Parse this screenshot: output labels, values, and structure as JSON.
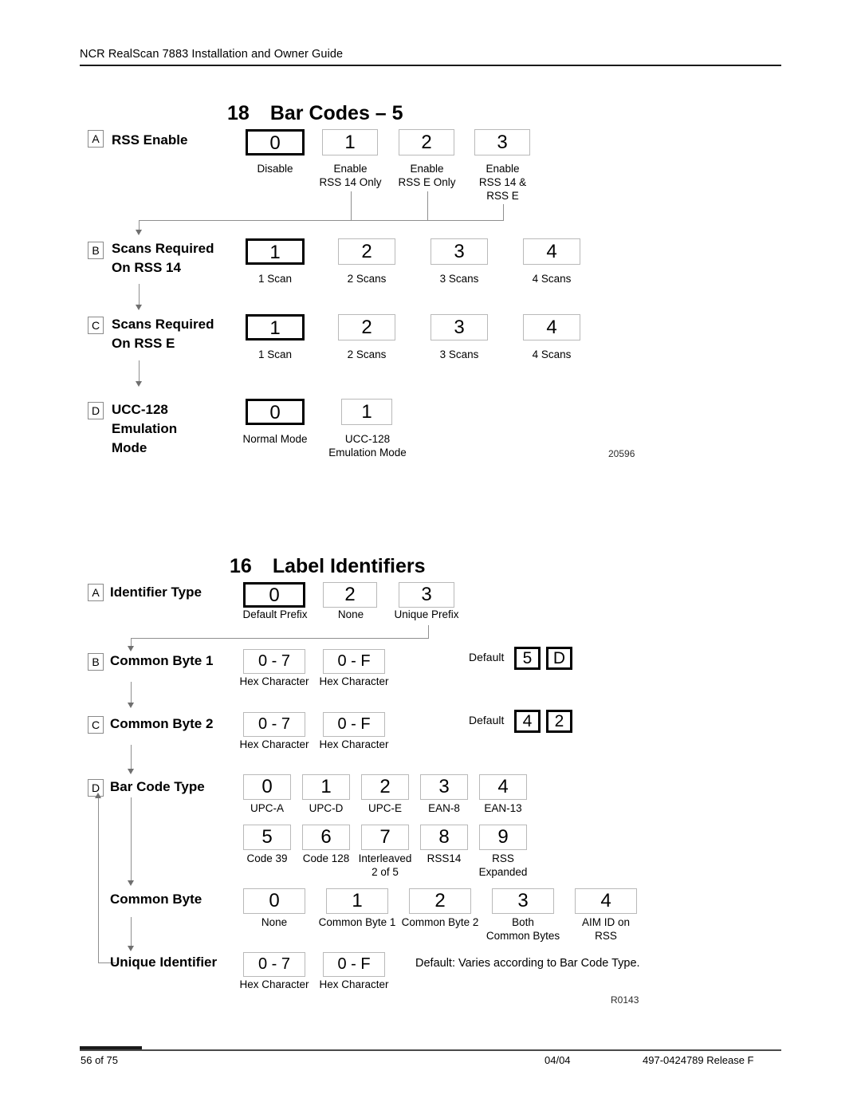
{
  "header": {
    "title": "NCR RealScan 7883 Installation and Owner Guide"
  },
  "footer": {
    "page": "56 of 75",
    "date": "04/04",
    "doc": "497-0424789  Release F"
  },
  "section_barcodes": {
    "number": "18",
    "title": "Bar Codes – 5",
    "figref": "20596",
    "rows": [
      {
        "badge": "A",
        "label": "RSS Enable",
        "boxes": [
          {
            "value": "0",
            "caption": "Disable",
            "selected": true
          },
          {
            "value": "1",
            "caption": "Enable\nRSS 14 Only",
            "selected": false
          },
          {
            "value": "2",
            "caption": "Enable\nRSS E Only",
            "selected": false
          },
          {
            "value": "3",
            "caption": "Enable\nRSS 14 &\nRSS E",
            "selected": false
          }
        ]
      },
      {
        "badge": "B",
        "label": "Scans Required\nOn RSS 14",
        "boxes": [
          {
            "value": "1",
            "caption": "1 Scan",
            "selected": true
          },
          {
            "value": "2",
            "caption": "2 Scans",
            "selected": false
          },
          {
            "value": "3",
            "caption": "3 Scans",
            "selected": false
          },
          {
            "value": "4",
            "caption": "4 Scans",
            "selected": false
          }
        ]
      },
      {
        "badge": "C",
        "label": "Scans Required\nOn RSS E",
        "boxes": [
          {
            "value": "1",
            "caption": "1 Scan",
            "selected": true
          },
          {
            "value": "2",
            "caption": "2 Scans",
            "selected": false
          },
          {
            "value": "3",
            "caption": "3 Scans",
            "selected": false
          },
          {
            "value": "4",
            "caption": "4 Scans",
            "selected": false
          }
        ]
      },
      {
        "badge": "D",
        "label": "UCC-128\nEmulation\nMode",
        "boxes": [
          {
            "value": "0",
            "caption": "Normal Mode",
            "selected": true
          },
          {
            "value": "1",
            "caption": "UCC-128\nEmulation Mode",
            "selected": false
          }
        ]
      }
    ]
  },
  "section_labelids": {
    "number": "16",
    "title": "Label Identifiers",
    "figref": "R0143",
    "default_label": "Default",
    "unique_default_note": "Default: Varies according to Bar Code Type.",
    "rows": [
      {
        "badge": "A",
        "label": "Identifier Type",
        "boxes": [
          {
            "value": "0",
            "caption": "Default Prefix",
            "selected": true
          },
          {
            "value": "2",
            "caption": "None",
            "selected": false
          },
          {
            "value": "3",
            "caption": "Unique Prefix",
            "selected": false
          }
        ]
      },
      {
        "badge": "B",
        "label": "Common Byte 1",
        "boxes": [
          {
            "value": "0 - 7",
            "caption": "Hex Character",
            "selected": false
          },
          {
            "value": "0 - F",
            "caption": "Hex Character",
            "selected": false
          }
        ],
        "defaults": [
          "5",
          "D"
        ]
      },
      {
        "badge": "C",
        "label": "Common Byte 2",
        "boxes": [
          {
            "value": "0 - 7",
            "caption": "Hex Character",
            "selected": false
          },
          {
            "value": "0 - F",
            "caption": "Hex Character",
            "selected": false
          }
        ],
        "defaults": [
          "4",
          "2"
        ]
      },
      {
        "badge": "D",
        "label": "Bar Code Type",
        "boxes": [
          {
            "value": "0",
            "caption": "UPC-A",
            "selected": false
          },
          {
            "value": "1",
            "caption": "UPC-D",
            "selected": false
          },
          {
            "value": "2",
            "caption": "UPC-E",
            "selected": false
          },
          {
            "value": "3",
            "caption": "EAN-8",
            "selected": false
          },
          {
            "value": "4",
            "caption": "EAN-13",
            "selected": false
          }
        ],
        "boxes2": [
          {
            "value": "5",
            "caption": "Code 39",
            "selected": false
          },
          {
            "value": "6",
            "caption": "Code 128",
            "selected": false
          },
          {
            "value": "7",
            "caption": "Interleaved\n2 of 5",
            "selected": false
          },
          {
            "value": "8",
            "caption": "RSS14",
            "selected": false
          },
          {
            "value": "9",
            "caption": "RSS\nExpanded",
            "selected": false
          }
        ]
      },
      {
        "badge": "",
        "label": "Common Byte",
        "boxes": [
          {
            "value": "0",
            "caption": "None",
            "selected": false
          },
          {
            "value": "1",
            "caption": "Common Byte 1",
            "selected": false
          },
          {
            "value": "2",
            "caption": "Common Byte 2",
            "selected": false
          },
          {
            "value": "3",
            "caption": "Both\nCommon Bytes",
            "selected": false
          },
          {
            "value": "4",
            "caption": "AIM ID on\nRSS",
            "selected": false
          }
        ]
      },
      {
        "badge": "",
        "label": "Unique Identifier",
        "boxes": [
          {
            "value": "0 - 7",
            "caption": "Hex Character",
            "selected": false
          },
          {
            "value": "0 - F",
            "caption": "Hex Character",
            "selected": false
          }
        ]
      }
    ]
  }
}
